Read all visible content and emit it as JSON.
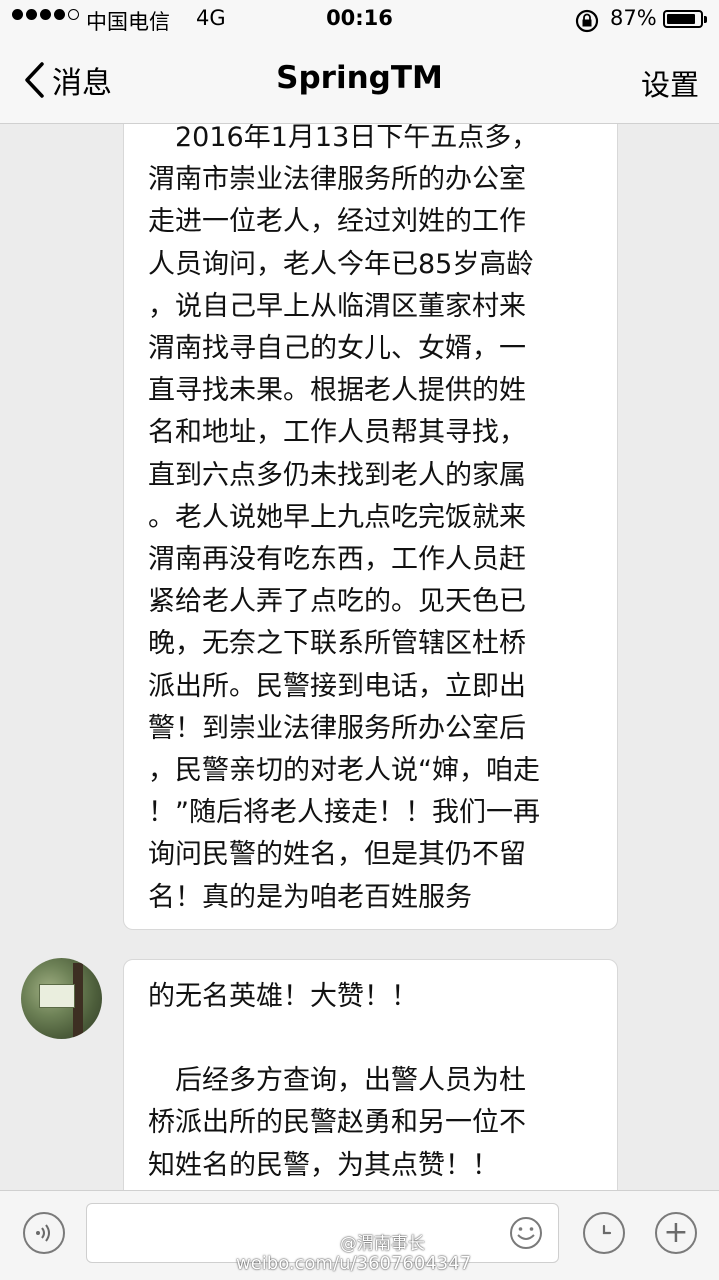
{
  "status_bar": {
    "carrier": "中国电信",
    "network": "4G",
    "time": "00:16",
    "battery_percent": "87%",
    "battery_level": 0.87
  },
  "nav": {
    "back_label": "消息",
    "title": "SpringTM",
    "settings_label": "设置"
  },
  "messages": [
    {
      "lines": [
        "　2016年1月13日下午五点多，",
        "渭南市崇业法律服务所的办公室",
        "走进一位老人，经过刘姓的工作",
        "人员询问，老人今年已85岁高龄",
        "，说自己早上从临渭区董家村来",
        "渭南找寻自己的女儿、女婿，一",
        "直寻找未果。根据老人提供的姓",
        "名和地址，工作人员帮其寻找，",
        "直到六点多仍未找到老人的家属",
        "。老人说她早上九点吃完饭就来",
        "渭南再没有吃东西，工作人员赶",
        "紧给老人弄了点吃的。见天色已",
        "晚，无奈之下联系所管辖区杜桥",
        "派出所。民警接到电话，立即出",
        "警！到崇业法律服务所办公室后",
        "，民警亲切的对老人说“婶，咱走",
        "！”随后将老人接走！！我们一再",
        "询问民警的姓名，但是其仍不留",
        "名！真的是为咱老百姓服务"
      ]
    },
    {
      "lines_a": [
        "的无名英雄！大赞！！"
      ],
      "lines_b": [
        "　后经多方查询，出警人员为杜",
        "桥派出所的民警赵勇和另一位不",
        "知姓名的民警，为其点赞！！"
      ]
    }
  ],
  "input": {
    "value": "",
    "plus_label": "+"
  },
  "watermark": {
    "handle": "@渭南事长",
    "url": "weibo.com/u/3607604347"
  }
}
